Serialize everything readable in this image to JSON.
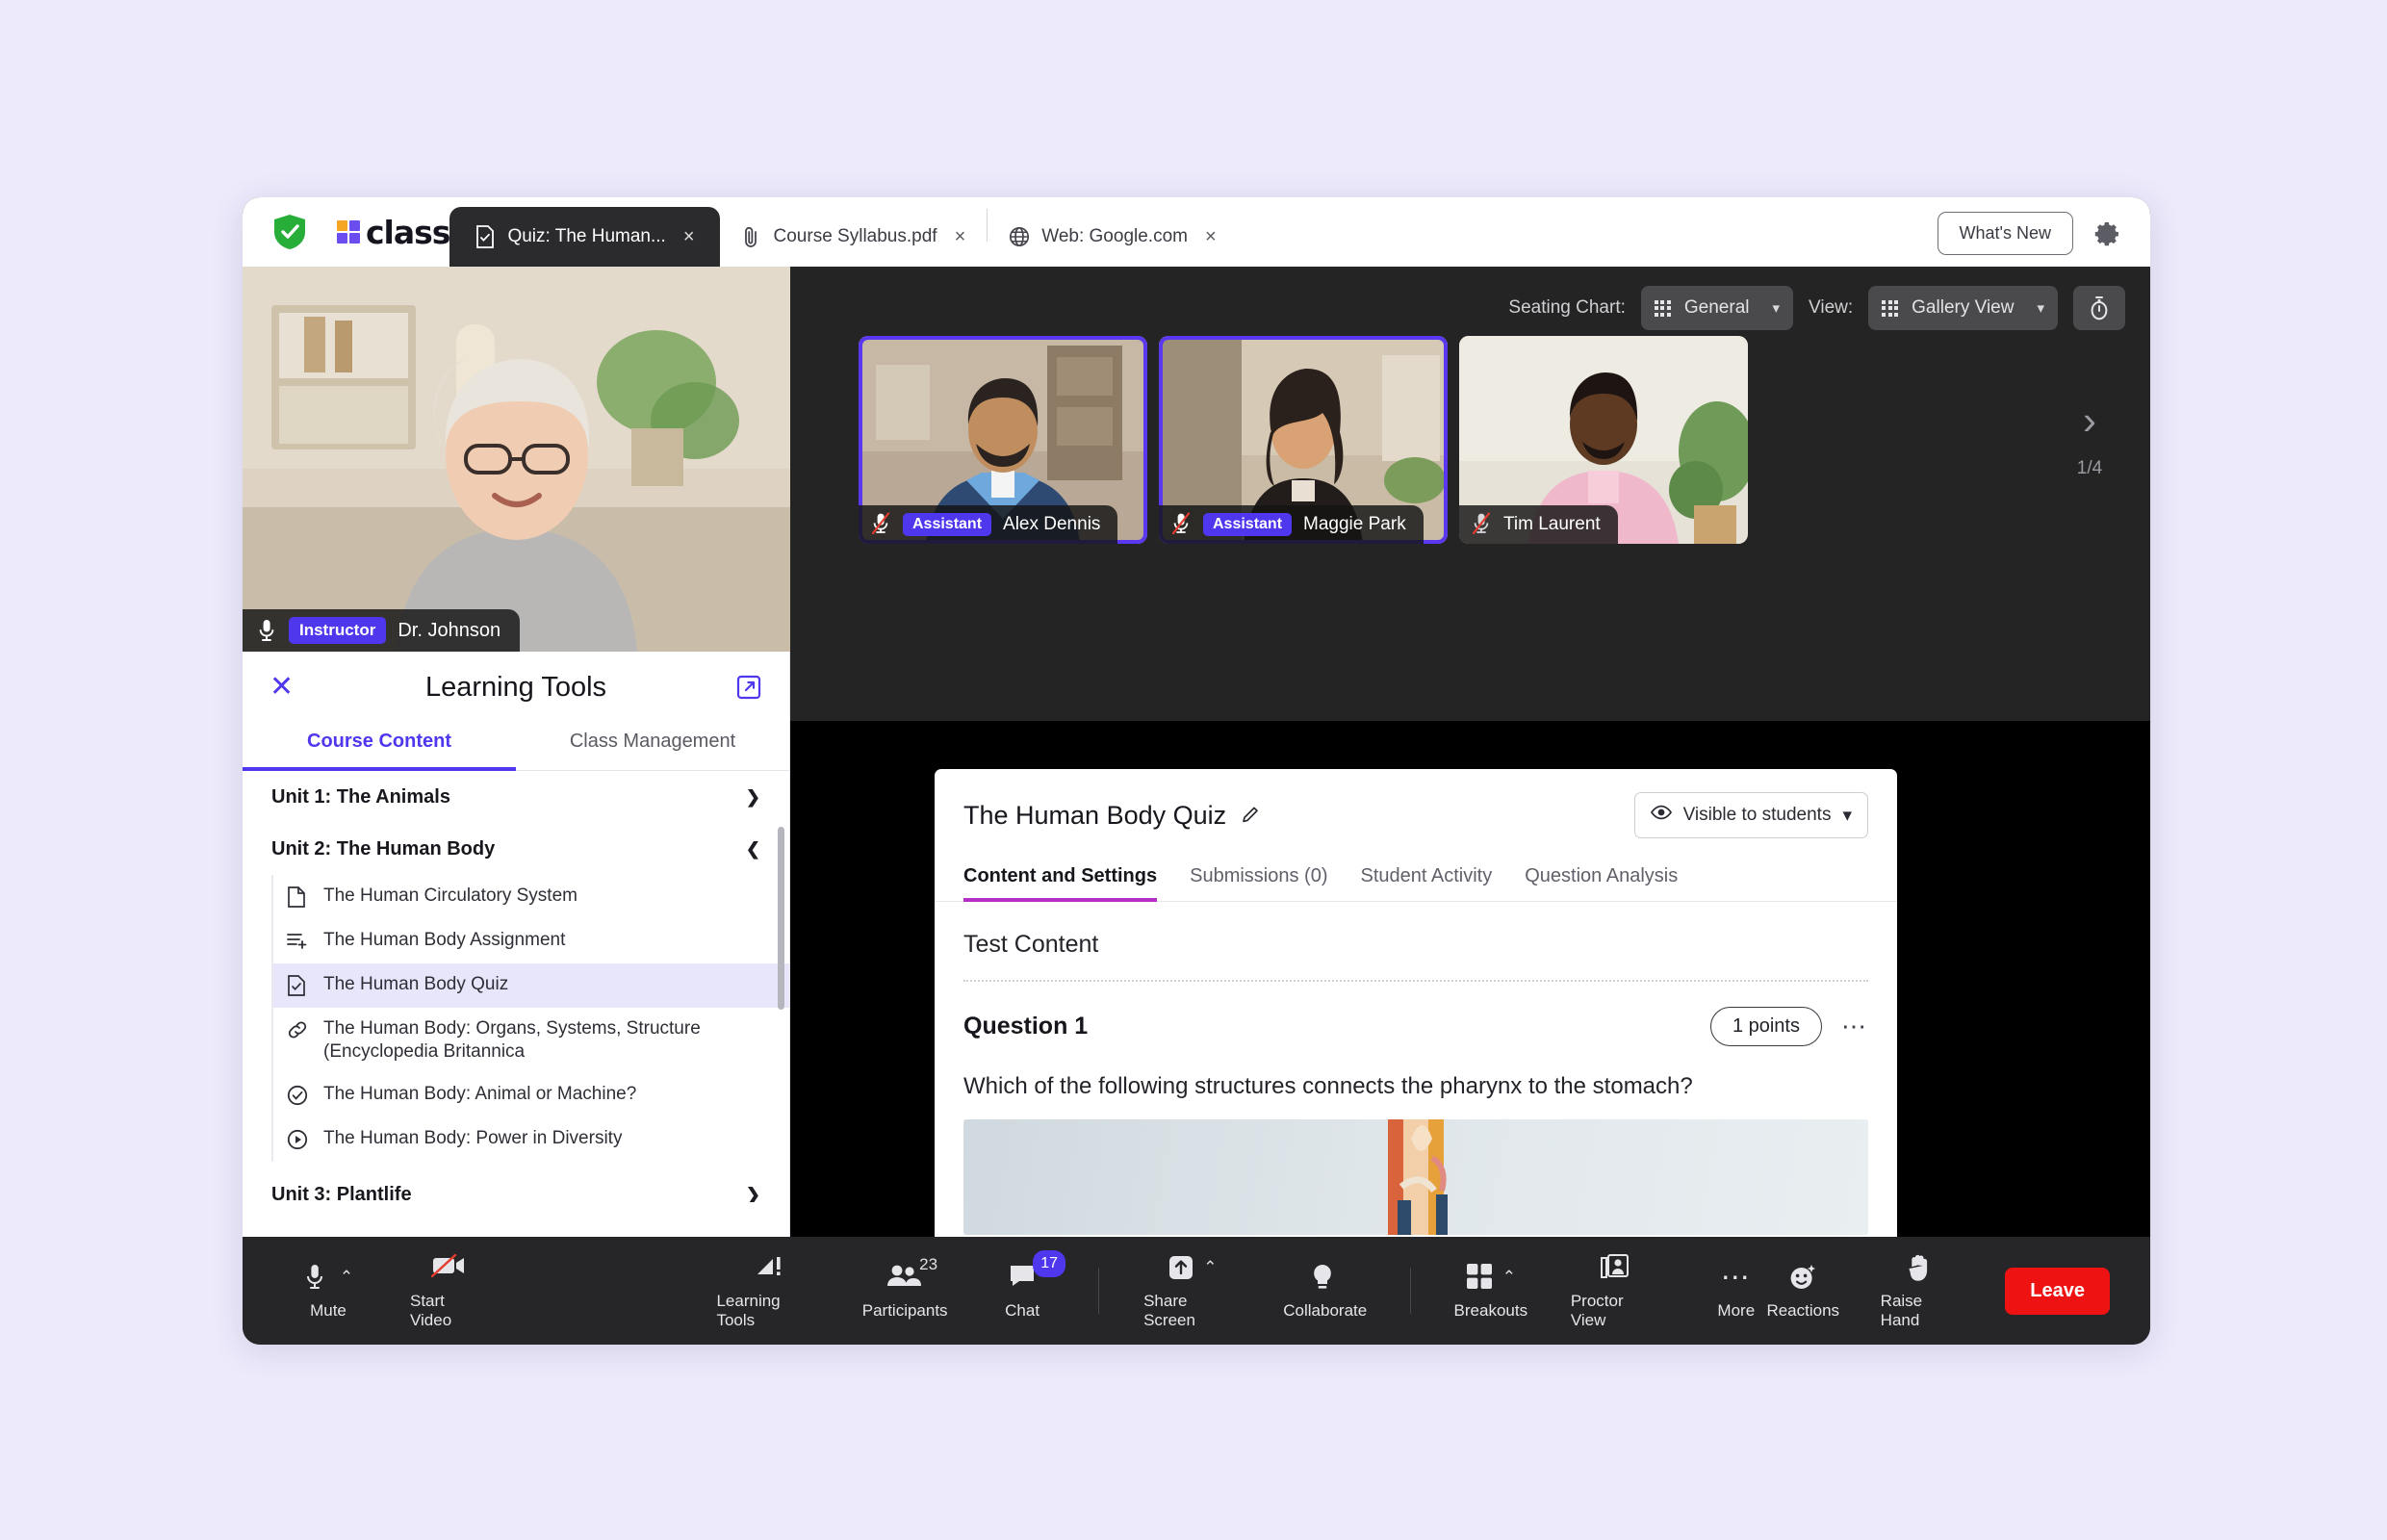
{
  "window": {
    "brand": "class",
    "shield_icon": "shield-check-icon",
    "gear_icon": "gear-icon",
    "whats_new_label": "What's New",
    "accent": "#4f37ee",
    "tab_accent": "#b52fc6",
    "leave_color": "#ef1212"
  },
  "tabs": [
    {
      "label": "Quiz: The Human...",
      "icon": "quiz-doc-icon",
      "close": "×",
      "active": true
    },
    {
      "label": "Course Syllabus.pdf",
      "icon": "paperclip-icon",
      "close": "×",
      "active": false
    },
    {
      "label": "Web: Google.com",
      "icon": "globe-icon",
      "close": "×",
      "active": false
    }
  ],
  "video": {
    "seating_chart_label": "Seating Chart:",
    "seating_chart_value": "General",
    "view_label": "View:",
    "view_value": "Gallery View",
    "timer_icon": "timer-icon",
    "chevron": "⌄",
    "pager_left_count": "1/4",
    "pager_right_count": "1/4",
    "instructor": {
      "role": "Instructor",
      "name": "Dr. Johnson",
      "mic": "mic-on-icon"
    },
    "participants": [
      {
        "role": "Assistant",
        "name": "Alex Dennis",
        "mic": "mic-muted-icon",
        "speaking": true
      },
      {
        "role": "Assistant",
        "name": "Maggie Park",
        "mic": "mic-muted-icon",
        "speaking": true
      },
      {
        "role": "",
        "name": "Tim Laurent",
        "mic": "mic-muted-icon",
        "speaking": false
      }
    ]
  },
  "learning_tools": {
    "title": "Learning Tools",
    "close_icon": "close-icon",
    "popout_icon": "open-in-new-icon",
    "tabs": [
      {
        "label": "Course Content",
        "active": true
      },
      {
        "label": "Class Management",
        "active": false
      }
    ],
    "tree": [
      {
        "type": "unit",
        "label": "Unit 1: The Animals",
        "expanded": false,
        "chevron": "›"
      },
      {
        "type": "unit",
        "label": "Unit 2: The Human Body",
        "expanded": true,
        "chevron": "⌄"
      },
      {
        "type": "item",
        "label": "The Human Circulatory System",
        "icon": "document-icon",
        "selected": false
      },
      {
        "type": "item",
        "label": "The Human Body Assignment",
        "icon": "assignment-icon",
        "selected": false
      },
      {
        "type": "item",
        "label": "The Human Body Quiz",
        "icon": "quiz-doc-icon",
        "selected": true
      },
      {
        "type": "item",
        "label": "The Human Body: Organs, Systems, Structure (Encyclopedia Britannica",
        "icon": "link-icon",
        "selected": false
      },
      {
        "type": "item",
        "label": "The Human Body: Animal or Machine?",
        "icon": "check-circle-icon",
        "selected": false
      },
      {
        "type": "item",
        "label": "The Human Body: Power in Diversity",
        "icon": "play-circle-icon",
        "selected": false
      },
      {
        "type": "unit",
        "label": "Unit 3: Plantlife",
        "expanded": false,
        "chevron": "›"
      }
    ]
  },
  "quiz": {
    "title": "The Human Body Quiz",
    "edit_icon": "pencil-icon",
    "visibility_label": "Visible to students",
    "visibility_icon": "eye-icon",
    "visibility_chevron": "▾",
    "tabs": [
      {
        "label": "Content and Settings",
        "active": true
      },
      {
        "label": "Submissions (0)",
        "active": false
      },
      {
        "label": "Student Activity",
        "active": false
      },
      {
        "label": "Question Analysis",
        "active": false
      }
    ],
    "section_label": "Test Content",
    "question_label": "Question 1",
    "points": "1 points",
    "menu_icon": "more-horizontal-icon",
    "question_text": "Which of the following structures connects the pharynx to the stomach?",
    "question_image_alt": "human-anatomy-illustration"
  },
  "toolbar": {
    "items": [
      {
        "label": "Mute",
        "icon": "mic-icon",
        "caret": "⌃",
        "badge": ""
      },
      {
        "label": "Start Video",
        "icon": "video-off-icon",
        "caret": "",
        "badge": ""
      },
      {
        "label": "Learning Tools",
        "icon": "learning-tools-icon",
        "caret": "",
        "badge": ""
      },
      {
        "label": "Participants",
        "icon": "participants-icon",
        "caret": "",
        "badge": "23"
      },
      {
        "label": "Chat",
        "icon": "chat-icon",
        "caret": "",
        "badge": "17"
      },
      {
        "label": "Share Screen",
        "icon": "share-screen-icon",
        "caret": "⌃",
        "badge": ""
      },
      {
        "label": "Collaborate",
        "icon": "lightbulb-icon",
        "caret": "",
        "badge": ""
      },
      {
        "label": "Breakouts",
        "icon": "breakouts-icon",
        "caret": "⌃",
        "badge": ""
      },
      {
        "label": "Proctor View",
        "icon": "proctor-view-icon",
        "caret": "",
        "badge": ""
      },
      {
        "label": "More",
        "icon": "more-horizontal-icon",
        "caret": "",
        "badge": ""
      },
      {
        "label": "Reactions",
        "icon": "reactions-icon",
        "caret": "",
        "badge": ""
      },
      {
        "label": "Raise Hand",
        "icon": "raise-hand-icon",
        "caret": "",
        "badge": ""
      }
    ],
    "leave_label": "Leave"
  }
}
